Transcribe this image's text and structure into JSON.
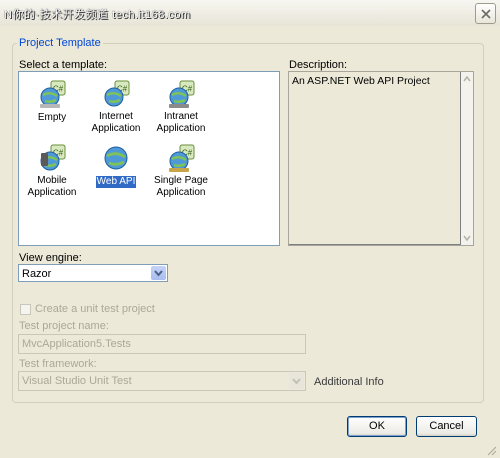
{
  "window": {
    "title": "N你的·技术开发频道 tech.it168.com"
  },
  "group": {
    "legend": "Project Template"
  },
  "templates": {
    "label": "Select a template:",
    "items": [
      {
        "label": "Empty",
        "icon": "cs-web-project-icon",
        "selected": false
      },
      {
        "label": "Internet Application",
        "icon": "cs-web-project-icon",
        "selected": false
      },
      {
        "label": "Intranet Application",
        "icon": "cs-web-project-icon",
        "selected": false
      },
      {
        "label": "Mobile Application",
        "icon": "cs-web-project-icon",
        "selected": false
      },
      {
        "label": "Web API",
        "icon": "cs-web-project-icon",
        "selected": true
      },
      {
        "label": "Single Page Application",
        "icon": "cs-web-project-icon",
        "selected": false
      }
    ]
  },
  "description": {
    "label": "Description:",
    "text": "An ASP.NET Web API Project"
  },
  "view_engine": {
    "label": "View engine:",
    "value": "Razor"
  },
  "unit_test": {
    "checkbox_label": "Create a unit test project",
    "checked": false,
    "project_name_label": "Test project name:",
    "project_name_value": "MvcApplication5.Tests",
    "framework_label": "Test framework:",
    "framework_value": "Visual Studio Unit Test",
    "additional_info": "Additional Info"
  },
  "buttons": {
    "ok": "OK",
    "cancel": "Cancel"
  },
  "colors": {
    "dialog_bg": "#ece9d8",
    "group_legend": "#0046d5",
    "selection": "#316ac5",
    "disabled_text": "#aca899"
  }
}
